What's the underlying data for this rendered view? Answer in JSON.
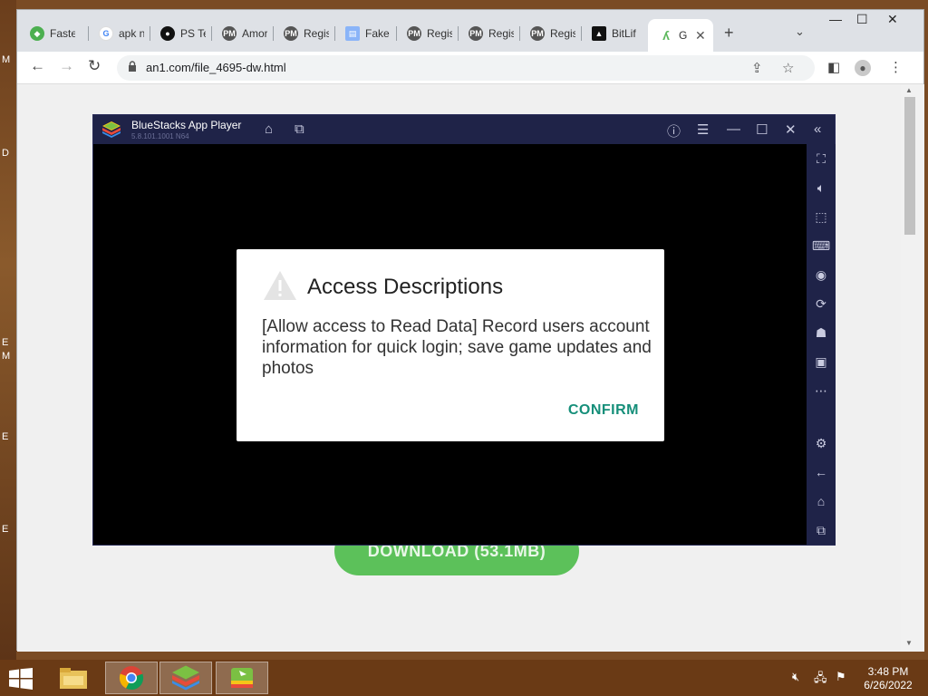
{
  "desktop": {
    "edge_letters": [
      "M",
      "D",
      "E",
      "M",
      "E",
      "E"
    ]
  },
  "browser": {
    "tabs": [
      {
        "label": "Faste",
        "icon": "bluestacks-icon"
      },
      {
        "label": "apk n",
        "icon": "google-icon"
      },
      {
        "label": "PS Te",
        "icon": "github-icon"
      },
      {
        "label": "Amor",
        "icon": "pm-icon"
      },
      {
        "label": "Regis",
        "icon": "pm-icon"
      },
      {
        "label": "Fake",
        "icon": "doc-icon"
      },
      {
        "label": "Regis",
        "icon": "pm-icon"
      },
      {
        "label": "Regis",
        "icon": "pm-icon"
      },
      {
        "label": "Regis",
        "icon": "pm-icon"
      },
      {
        "label": "BitLif",
        "icon": "bitlife-icon"
      },
      {
        "label": "G",
        "icon": "an1-icon"
      }
    ],
    "url": "an1.com/file_4695-dw.html",
    "page": {
      "download_label": "DOWNLOAD (53.1MB)"
    }
  },
  "bluestacks": {
    "title": "BlueStacks App Player",
    "version": "5.8.101.1001 N64",
    "dialog": {
      "title": "Access Descriptions",
      "body": "[Allow access to Read Data] Record users account information for quick login; save game updates and photos",
      "confirm_label": "CONFIRM"
    }
  },
  "taskbar": {
    "time": "3:48 PM",
    "date": "6/26/2022"
  },
  "colors": {
    "accent_confirm": "#168f7a",
    "bluestacks_chrome": "#1f2348",
    "download_green": "#5cc15a",
    "taskbar": "#6a3a15"
  }
}
